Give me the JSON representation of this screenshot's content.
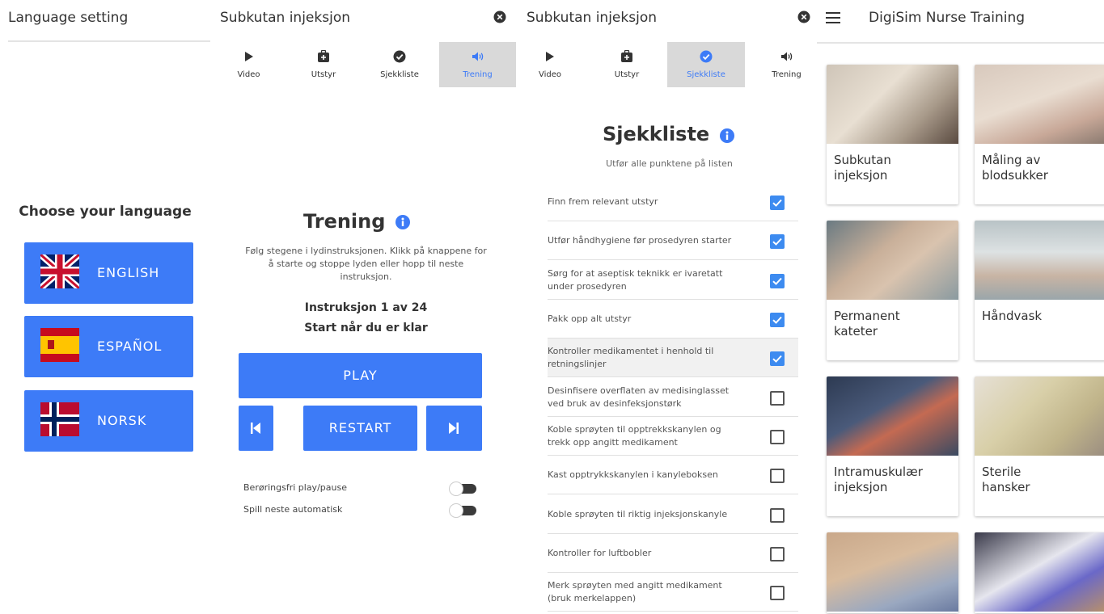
{
  "colors": {
    "accent": "#3d7bf7",
    "check": "#3d8bf0",
    "active_tab_bg": "#d9d9d9"
  },
  "language_panel": {
    "title": "Language setting",
    "heading": "Choose your language",
    "languages": [
      {
        "label": "ENGLISH",
        "flag": "uk-flag-icon"
      },
      {
        "label": "ESPAÑOL",
        "flag": "spain-flag-icon"
      },
      {
        "label": "NORSK",
        "flag": "norway-flag-icon"
      }
    ]
  },
  "training_panel": {
    "title": "Subkutan injeksjon",
    "tabs": [
      {
        "label": "Video",
        "icon": "play-icon"
      },
      {
        "label": "Utstyr",
        "icon": "kit-icon"
      },
      {
        "label": "Sjekkliste",
        "icon": "check-circle-icon"
      },
      {
        "label": "Trening",
        "icon": "speaker-icon",
        "active": true
      }
    ],
    "heading": "Trening",
    "description_lines": [
      "Følg stegene i lydinstruksjonen. Klikk på knappene for",
      "å starte og stoppe lyden eller hopp til neste",
      "instruksjon."
    ],
    "instruction_counter": "Instruksjon 1 av 24",
    "instruction_status": "Start når du er klar",
    "play_label": "PLAY",
    "restart_label": "RESTART",
    "toggles": [
      {
        "label": "Berøringsfri play/pause",
        "on": false
      },
      {
        "label": "Spill neste automatisk",
        "on": false
      }
    ]
  },
  "checklist_panel": {
    "title": "Subkutan injeksjon",
    "tabs": [
      {
        "label": "Video",
        "icon": "play-icon"
      },
      {
        "label": "Utstyr",
        "icon": "kit-icon"
      },
      {
        "label": "Sjekkliste",
        "icon": "check-circle-icon",
        "active": true
      },
      {
        "label": "Trening",
        "icon": "speaker-icon"
      }
    ],
    "heading": "Sjekkliste",
    "subtitle": "Utfør alle punktene på listen",
    "items": [
      {
        "lines": [
          "Finn frem relevant utstyr"
        ],
        "checked": true
      },
      {
        "lines": [
          "Utfør håndhygiene før prosedyren starter"
        ],
        "checked": true
      },
      {
        "lines": [
          "Sørg for at aseptisk teknikk er ivaretatt",
          "under prosedyren"
        ],
        "checked": true
      },
      {
        "lines": [
          "Pakk opp alt utstyr"
        ],
        "checked": true
      },
      {
        "lines": [
          "Kontroller medikamentet i henhold til",
          "retningslinjer"
        ],
        "checked": true,
        "highlighted": true
      },
      {
        "lines": [
          "Desinfisere overflaten av medisinglasset",
          "ved bruk av desinfeksjonstørk"
        ],
        "checked": false
      },
      {
        "lines": [
          "Koble sprøyten til opptrekkskanylen og",
          "trekk opp angitt medikament"
        ],
        "checked": false
      },
      {
        "lines": [
          "Kast opptrykkskanylen i kanyleboksen"
        ],
        "checked": false
      },
      {
        "lines": [
          "Koble sprøyten til riktig injeksjonskanyle"
        ],
        "checked": false
      },
      {
        "lines": [
          "Kontroller for luftbobler"
        ],
        "checked": false
      },
      {
        "lines": [
          "Merk sprøyten med angitt medikament",
          "(bruk merkelappen)"
        ],
        "checked": false
      }
    ]
  },
  "catalog_panel": {
    "title": "DigiSim Nurse Training",
    "cards": [
      {
        "lines": [
          "Subkutan",
          "injeksjon"
        ]
      },
      {
        "lines": [
          "Måling av",
          "blodsukker"
        ]
      },
      {
        "lines": [
          "Permanent",
          "kateter"
        ]
      },
      {
        "lines": [
          "Håndvask"
        ]
      },
      {
        "lines": [
          "Intramuskulær",
          "injeksjon"
        ]
      },
      {
        "lines": [
          "Sterile",
          "hansker"
        ]
      },
      {
        "lines": []
      },
      {
        "lines": []
      }
    ]
  }
}
